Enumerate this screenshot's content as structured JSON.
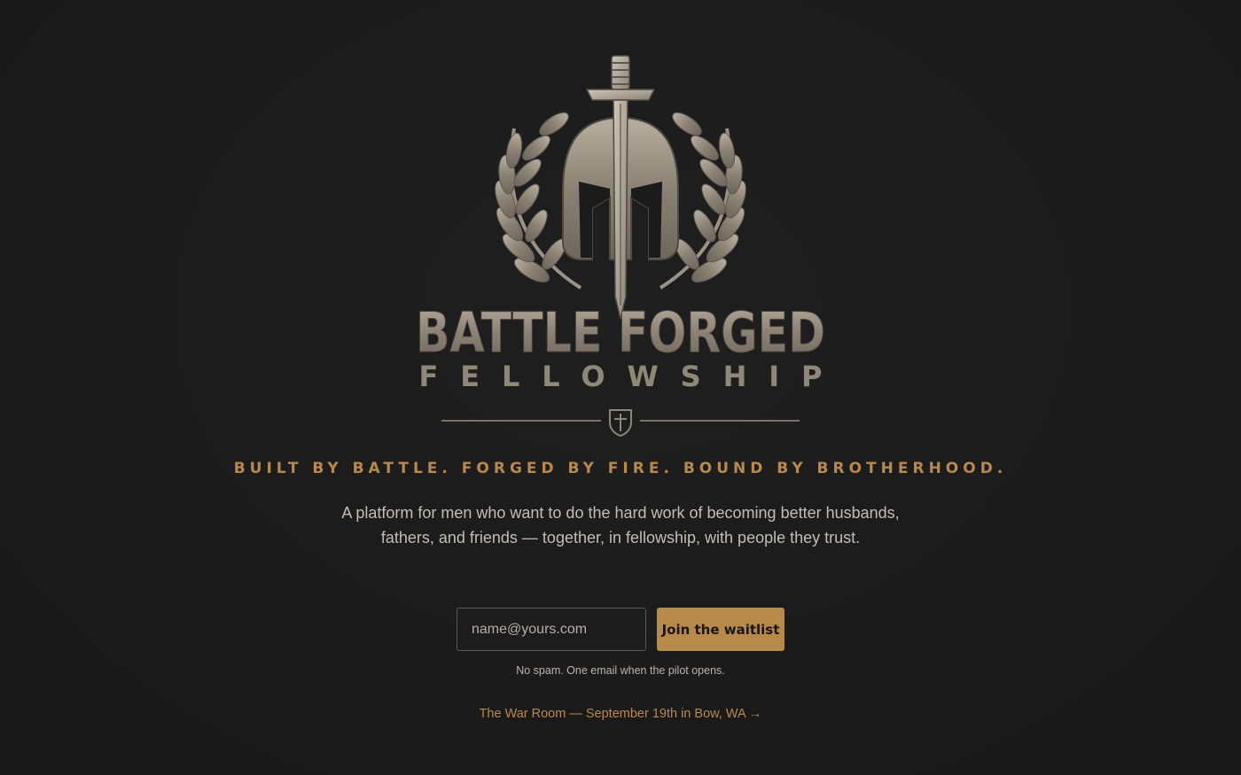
{
  "brand": {
    "logo_line1": "BATTLE FORGED",
    "logo_line2": "FELLOWSHIP",
    "logo_icons": [
      "spartan-helmet-icon",
      "sword-icon",
      "laurel-wreath-icon",
      "shield-cross-icon"
    ]
  },
  "hero": {
    "tagline": "BUILT BY BATTLE. FORGED BY FIRE. BOUND BY BROTHERHOOD.",
    "description": "A platform for men who want to do the hard work of becoming better husbands, fathers, and friends — together, in fellowship, with people they trust."
  },
  "waitlist": {
    "email_placeholder": "name@yours.com",
    "email_value": "",
    "button_label": "Join the waitlist",
    "note": "No spam. One email when the pilot opens."
  },
  "event": {
    "link_text": "The War Room — September 19th in Bow, WA →"
  },
  "colors": {
    "background": "#1b1b1b",
    "accent_gold": "#b8894a",
    "text_muted": "#c3beb5",
    "metal": "#8f8778"
  }
}
